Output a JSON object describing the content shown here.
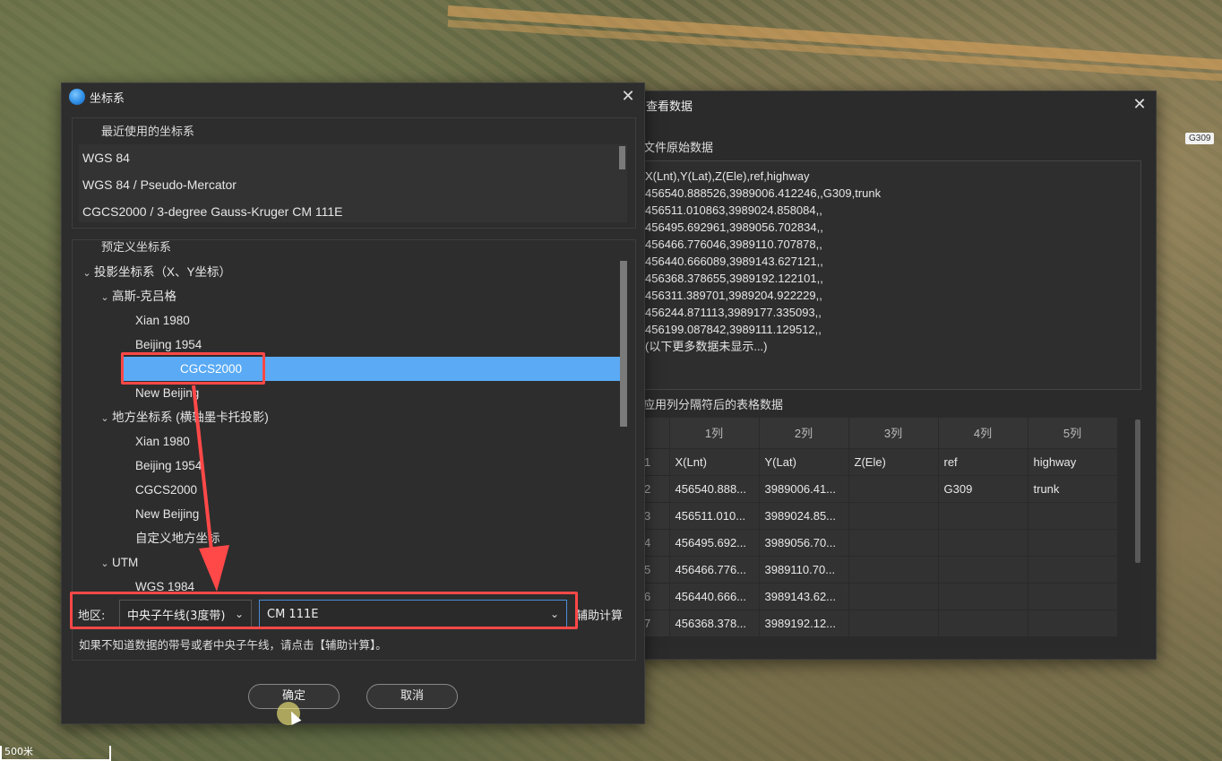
{
  "map": {
    "road_badge": "G309",
    "scale_label": "500米"
  },
  "coord_dialog": {
    "title": "坐标系",
    "close_icon": "close-icon",
    "recent_title": "最近使用的坐标系",
    "recent_items": [
      "WGS 84",
      "WGS 84 / Pseudo-Mercator",
      "CGCS2000 / 3-degree Gauss-Kruger CM 111E"
    ],
    "predefined_title": "预定义坐标系",
    "tree": [
      {
        "label": "投影坐标系（X、Y坐标）",
        "level": 0,
        "expanded": true
      },
      {
        "label": "高斯-克吕格",
        "level": 1,
        "expanded": true
      },
      {
        "label": "Xian 1980",
        "level": 2
      },
      {
        "label": "Beijing 1954",
        "level": 2
      },
      {
        "label": "CGCS2000",
        "level": 2,
        "selected": true
      },
      {
        "label": "New Beijing",
        "level": 2
      },
      {
        "label": "地方坐标系 (横轴墨卡托投影)",
        "level": 1,
        "expanded": true
      },
      {
        "label": "Xian 1980",
        "level": 2
      },
      {
        "label": "Beijing 1954",
        "level": 2
      },
      {
        "label": "CGCS2000",
        "level": 2
      },
      {
        "label": "New Beijing",
        "level": 2
      },
      {
        "label": "自定义地方坐标",
        "level": 2
      },
      {
        "label": "UTM",
        "level": 1,
        "expanded": true
      },
      {
        "label": "WGS 1984",
        "level": 2
      }
    ],
    "region_label": "地区:",
    "meridian_select": "中央子午线(3度带)",
    "cm_select": "CM 111E",
    "assist_button": "辅助计算",
    "hint": "如果不知道数据的带号或者中央子午线，请点击【辅助计算】。",
    "ok_button": "确定",
    "cancel_button": "取消"
  },
  "data_dialog": {
    "title": "查看数据",
    "raw_title": "文件原始数据",
    "raw_lines": [
      "X(Lnt),Y(Lat),Z(Ele),ref,highway",
      "456540.888526,3989006.412246,,G309,trunk",
      "456511.010863,3989024.858084,,",
      "456495.692961,3989056.702834,,",
      "456466.776046,3989110.707878,,",
      "456440.666089,3989143.627121,,",
      "456368.378655,3989192.122101,,",
      "456311.389701,3989204.922229,,",
      "456244.871113,3989177.335093,,",
      "456199.087842,3989111.129512,,",
      "(以下更多数据未显示...)"
    ],
    "table_title": "应用列分隔符后的表格数据",
    "columns": [
      "",
      "1列",
      "2列",
      "3列",
      "4列",
      "5列"
    ],
    "rows": [
      [
        "1",
        "X(Lnt)",
        "Y(Lat)",
        "Z(Ele)",
        "ref",
        "highway"
      ],
      [
        "2",
        "456540.888...",
        "3989006.41...",
        "",
        "G309",
        "trunk"
      ],
      [
        "3",
        "456511.010...",
        "3989024.85...",
        "",
        "",
        ""
      ],
      [
        "4",
        "456495.692...",
        "3989056.70...",
        "",
        "",
        ""
      ],
      [
        "5",
        "456466.776...",
        "3989110.70...",
        "",
        "",
        ""
      ],
      [
        "6",
        "456440.666...",
        "3989143.62...",
        "",
        "",
        ""
      ],
      [
        "7",
        "456368.378...",
        "3989192.12...",
        "",
        "",
        ""
      ]
    ]
  }
}
